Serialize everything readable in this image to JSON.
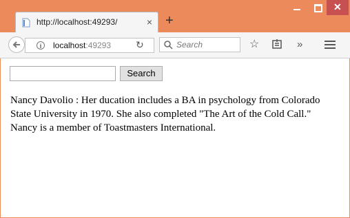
{
  "browser": {
    "tab_title": "http://localhost:49293/",
    "tab_close": "×",
    "new_tab": "+",
    "url_host": "localhost",
    "url_port": ":49293",
    "search_placeholder": "Search"
  },
  "page": {
    "search_value": "",
    "search_button_label": "Search",
    "result_text": "Nancy Davolio : Her ducation includes a BA in psychology from Colorado State University in 1970. She also completed \"The Art of the Cold Call.\" Nancy is a member of Toastmasters International."
  },
  "colors": {
    "window_frame": "#ec8a5c",
    "close_button": "#c75050"
  }
}
